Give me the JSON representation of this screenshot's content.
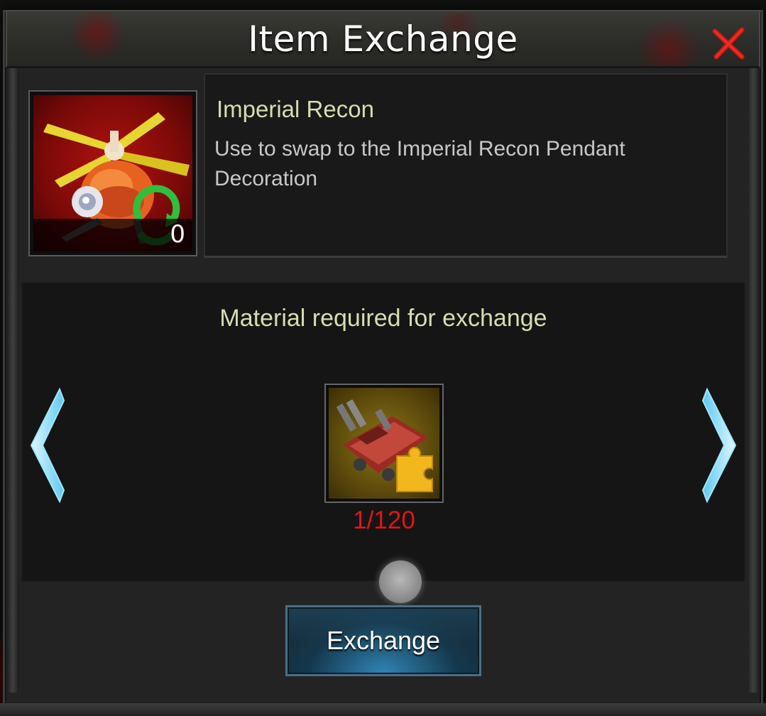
{
  "dialog": {
    "title": "Item Exchange"
  },
  "item": {
    "name": "Imperial Recon",
    "description": "Use to swap to the Imperial Recon Pendant Decoration",
    "owned_count": "0"
  },
  "materials": {
    "heading": "Material required for exchange",
    "quantity": "1/120",
    "quantity_color": "#e01515"
  },
  "actions": {
    "exchange_label": "Exchange"
  },
  "icons": {
    "close": "close-x-icon",
    "prev": "arrow-left-icon",
    "next": "arrow-right-icon",
    "item": "imperial-recon-drone-icon",
    "material": "vehicle-puzzle-piece-icon"
  },
  "colors": {
    "title_text": "#ffffff",
    "accent_text": "#d7ddae",
    "close": "#d51a12",
    "arrow_glow": "#9fe8ff",
    "button_blue": "#1d3f52"
  }
}
